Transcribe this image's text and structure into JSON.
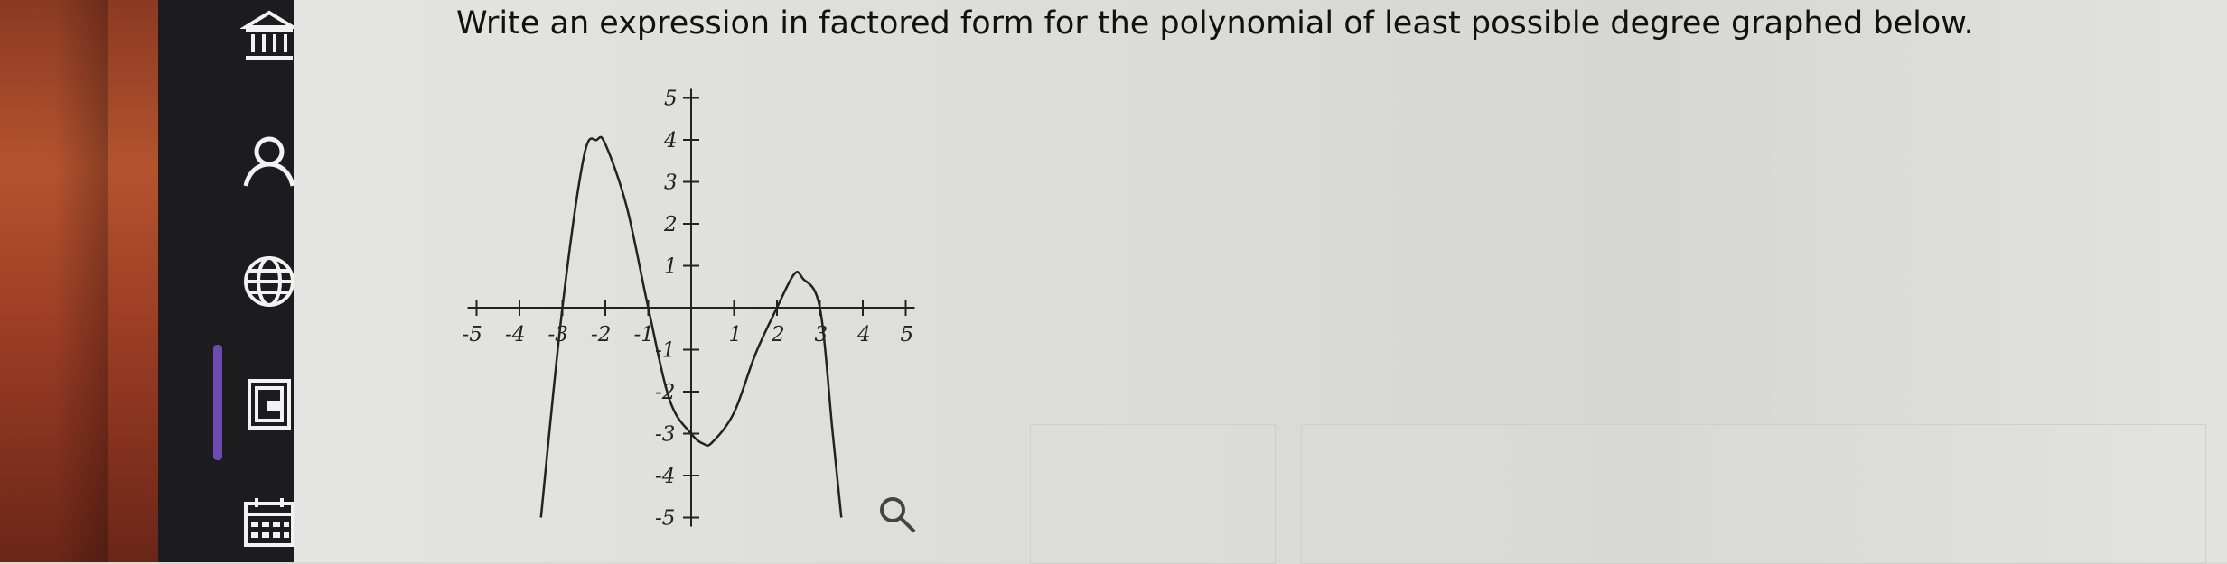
{
  "question": {
    "text": "Write an expression in factored form for the polynomial of least possible degree graphed below."
  },
  "sidebar": {
    "items": [
      {
        "name": "home",
        "icon": "bank-icon"
      },
      {
        "name": "profile",
        "icon": "user-icon"
      },
      {
        "name": "web",
        "icon": "globe-icon"
      },
      {
        "name": "assignments",
        "icon": "book-icon",
        "active": true
      },
      {
        "name": "calendar",
        "icon": "calendar-icon"
      }
    ],
    "accent_color": "#6b4bb0"
  },
  "graph": {
    "magnify_icon": "magnify-icon"
  },
  "chart_data": {
    "type": "line",
    "xlim": [
      -5,
      5
    ],
    "ylim": [
      -5,
      5
    ],
    "x_ticks": [
      -5,
      -4,
      -3,
      -2,
      -1,
      1,
      2,
      3,
      4,
      5
    ],
    "y_ticks": [
      -5,
      -4,
      -3,
      -2,
      -1,
      1,
      2,
      3,
      4,
      5
    ],
    "x_tick_labels": [
      "-5",
      "-4",
      "-3",
      "-2",
      "-1",
      "1",
      "2",
      "3",
      "4",
      "5"
    ],
    "y_tick_labels": [
      "-5",
      "-4",
      "-3",
      "-2",
      "-1",
      "1",
      "2",
      "3",
      "4",
      "5"
    ],
    "grid": false,
    "series": [
      {
        "x": [
          -3.5,
          -3.0,
          -2.5,
          -2.2,
          -2.0,
          -1.5,
          -1.0,
          -0.5,
          0.0,
          0.3,
          0.5,
          1.0,
          1.5,
          2.0,
          2.4,
          2.6,
          3.0,
          3.3,
          3.5
        ],
        "y": [
          -5.0,
          0.0,
          3.6,
          4.0,
          3.9,
          2.4,
          0.0,
          -2.2,
          -3.0,
          -3.25,
          -3.2,
          -2.5,
          -1.1,
          0.0,
          0.8,
          0.7,
          0.0,
          -3.0,
          -5.0
        ]
      }
    ]
  }
}
